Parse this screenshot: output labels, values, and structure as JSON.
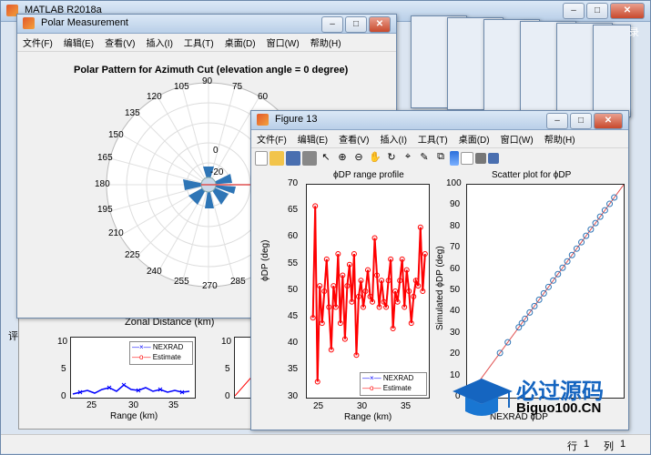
{
  "main": {
    "title": "MATLAB R2018a",
    "status_row_label": "行",
    "status_row": "1",
    "status_col_label": "列",
    "status_col": "1",
    "side_label": "录",
    "left_label": "评"
  },
  "polar": {
    "title": "Polar Measurement",
    "menu": [
      "文件(F)",
      "编辑(E)",
      "查看(V)",
      "插入(I)",
      "工具(T)",
      "桌面(D)",
      "窗口(W)",
      "帮助(H)"
    ],
    "plot_title": "Polar Pattern for Azimuth Cut (elevation angle = 0 degree)",
    "angles": [
      "90",
      "75",
      "60",
      "105",
      "120",
      "135",
      "150",
      "165",
      "180",
      "195",
      "210",
      "225",
      "240",
      "255",
      "270",
      "285"
    ],
    "radial_labels": [
      "0",
      "-20"
    ],
    "xlabel": "Zonal Distance (km)"
  },
  "bgplot": {
    "yticks": [
      "10",
      "5",
      "0"
    ],
    "xticks": [
      "25",
      "30",
      "35"
    ],
    "xlabel": "Range (km)",
    "legend": [
      "NEXRAD",
      "Estimate"
    ],
    "y2ticks": [
      "10",
      "5",
      "0"
    ]
  },
  "fig13": {
    "title": "Figure 13",
    "menu": [
      "文件(F)",
      "编辑(E)",
      "查看(V)",
      "插入(I)",
      "工具(T)",
      "桌面(D)",
      "窗口(W)",
      "帮助(H)"
    ],
    "left_title": "ϕDP range profile",
    "left_ylabel": "ϕDP (deg)",
    "left_xlabel": "Range (km)",
    "left_yticks": [
      "70",
      "65",
      "60",
      "55",
      "50",
      "45",
      "40",
      "35",
      "30"
    ],
    "left_xticks": [
      "25",
      "30",
      "35"
    ],
    "legend": [
      "NEXRAD",
      "Estimate"
    ],
    "right_title": "Scatter plot for ϕDP",
    "right_ylabel": "Simulated ϕDP (deg)",
    "right_xlabel": "NEXRAD ϕDP",
    "right_yticks": [
      "100",
      "90",
      "80",
      "70",
      "60",
      "50",
      "40",
      "30",
      "20",
      "10",
      "0"
    ]
  },
  "watermark": {
    "text": "必过源码",
    "url": "Biguo100.CN"
  },
  "chart_data": [
    {
      "type": "line",
      "title": "ϕDP range profile",
      "xlabel": "Range (km)",
      "ylabel": "ϕDP (deg)",
      "xlim": [
        22,
        38
      ],
      "ylim": [
        30,
        70
      ],
      "series": [
        {
          "name": "NEXRAD",
          "color": "#0000ff",
          "x": [
            22.8,
            23.1,
            23.4,
            23.7,
            24.0,
            24.3,
            24.6,
            24.9,
            25.2,
            25.5,
            25.8,
            26.1,
            26.4,
            26.7,
            27.0,
            27.3,
            27.6,
            27.9,
            28.2,
            28.5,
            28.8,
            29.1,
            29.4,
            29.7,
            30.0,
            30.3,
            30.6,
            30.9,
            31.2,
            31.5,
            31.8,
            32.1,
            32.4,
            32.7,
            33.0,
            33.3,
            33.6,
            33.9,
            34.2,
            34.5,
            34.8,
            35.1,
            35.4,
            35.7,
            36.0,
            36.3,
            36.6,
            36.9,
            37.2,
            37.5
          ],
          "y": [
            45,
            66,
            33,
            51,
            44,
            50,
            56,
            47,
            39,
            51,
            47,
            57,
            44,
            53,
            41,
            51,
            55,
            48,
            57,
            38,
            49,
            52,
            47,
            50,
            54,
            49,
            48,
            60,
            53,
            47,
            52,
            48,
            47,
            52,
            56,
            43,
            50,
            48,
            52,
            56,
            47,
            54,
            50,
            44,
            49,
            52,
            51,
            62,
            50,
            57
          ]
        },
        {
          "name": "Estimate",
          "color": "#ff0000",
          "x": [
            22.8,
            23.1,
            23.4,
            23.7,
            24.0,
            24.3,
            24.6,
            24.9,
            25.2,
            25.5,
            25.8,
            26.1,
            26.4,
            26.7,
            27.0,
            27.3,
            27.6,
            27.9,
            28.2,
            28.5,
            28.8,
            29.1,
            29.4,
            29.7,
            30.0,
            30.3,
            30.6,
            30.9,
            31.2,
            31.5,
            31.8,
            32.1,
            32.4,
            32.7,
            33.0,
            33.3,
            33.6,
            33.9,
            34.2,
            34.5,
            34.8,
            35.1,
            35.4,
            35.7,
            36.0,
            36.3,
            36.6,
            36.9,
            37.2,
            37.5
          ],
          "y": [
            45,
            66,
            33,
            51,
            44,
            50,
            56,
            47,
            39,
            51,
            47,
            57,
            44,
            53,
            41,
            51,
            55,
            48,
            57,
            38,
            49,
            52,
            47,
            50,
            54,
            49,
            48,
            60,
            53,
            47,
            52,
            48,
            47,
            52,
            56,
            43,
            50,
            48,
            52,
            56,
            47,
            54,
            50,
            44,
            49,
            52,
            51,
            62,
            50,
            57
          ]
        }
      ]
    },
    {
      "type": "scatter",
      "title": "Scatter plot for ϕDP",
      "xlabel": "NEXRAD ϕDP",
      "ylabel": "Simulated ϕDP (deg)",
      "ylim": [
        0,
        100
      ],
      "xlim": [
        0,
        100
      ],
      "series": [
        {
          "name": "",
          "color": "#2e75b6",
          "x": [
            21,
            26,
            33,
            35,
            37,
            40,
            43,
            46,
            49,
            52,
            55,
            58,
            61,
            64,
            67,
            70,
            73,
            76,
            79,
            82,
            85,
            88,
            91,
            94
          ],
          "y": [
            21,
            26,
            33,
            35,
            37,
            40,
            43,
            46,
            49,
            52,
            55,
            58,
            61,
            64,
            67,
            70,
            73,
            76,
            79,
            82,
            85,
            88,
            91,
            94
          ]
        }
      ]
    }
  ]
}
